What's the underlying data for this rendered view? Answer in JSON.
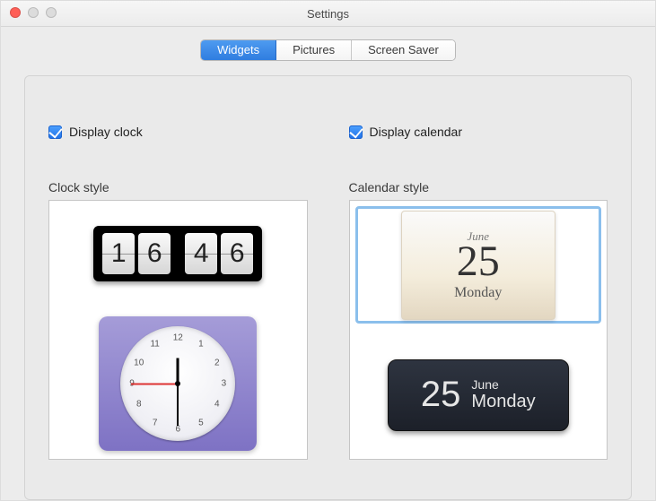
{
  "window": {
    "title": "Settings"
  },
  "tabs": {
    "widgets": "Widgets",
    "pictures": "Pictures",
    "screensaver": "Screen Saver",
    "selected": "widgets"
  },
  "widgets": {
    "clock_checkbox_label": "Display clock",
    "clock_checkbox_checked": true,
    "calendar_checkbox_label": "Display calendar",
    "calendar_checkbox_checked": true,
    "clock_style_label": "Clock style",
    "calendar_style_label": "Calendar style",
    "flip_clock_digits": {
      "d1": "1",
      "d2": "6",
      "d3": "4",
      "d4": "6"
    },
    "analog_numbers": {
      "n12": "12",
      "n1": "1",
      "n2": "2",
      "n3": "3",
      "n4": "4",
      "n5": "5",
      "n6": "6",
      "n7": "7",
      "n8": "8",
      "n9": "9",
      "n10": "10",
      "n11": "11"
    },
    "calendar_card": {
      "month": "June",
      "day": "25",
      "weekday": "Monday"
    },
    "calendar_dark": {
      "month": "June",
      "day": "25",
      "weekday": "Monday"
    },
    "calendar_selected_index": 0
  }
}
